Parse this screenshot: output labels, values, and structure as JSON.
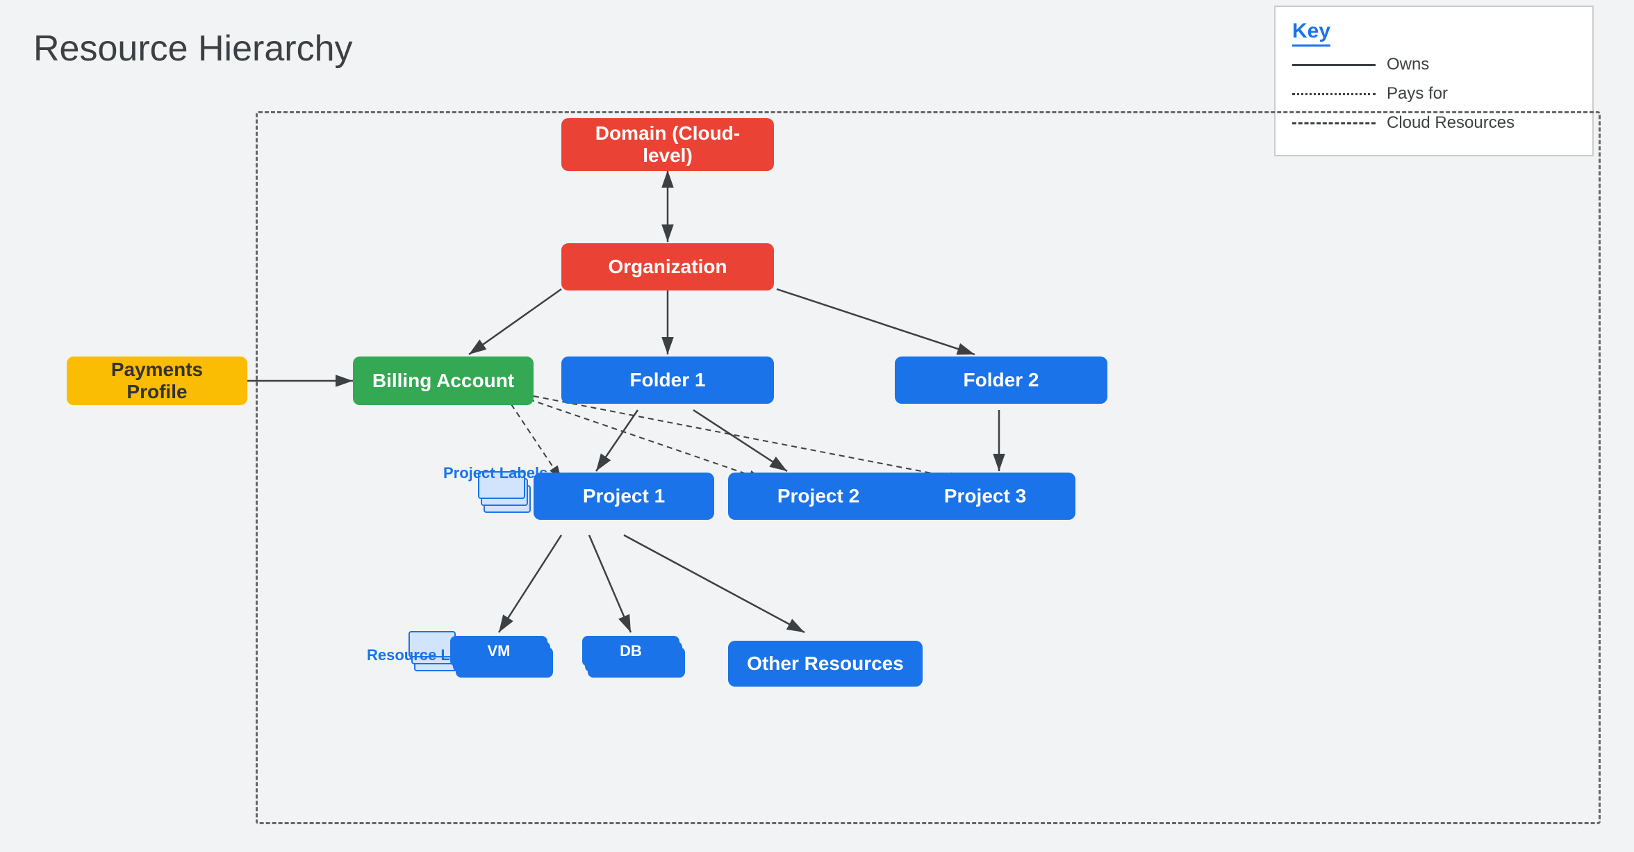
{
  "title": "Resource Hierarchy",
  "key": {
    "title": "Key",
    "items": [
      {
        "label": "Owns",
        "type": "solid"
      },
      {
        "label": "Pays for",
        "type": "dotted"
      },
      {
        "label": "Cloud Resources",
        "type": "dashed"
      }
    ]
  },
  "nodes": {
    "domain": "Domain (Cloud-level)",
    "organization": "Organization",
    "billingAccount": "Billing Account",
    "paymentsProfile": "Payments Profile",
    "folder1": "Folder 1",
    "folder2": "Folder 2",
    "project1": "Project 1",
    "project2": "Project 2",
    "project3": "Project 3",
    "vm": "VM",
    "db": "DB",
    "otherResources": "Other Resources",
    "projectLabels": "Project\nLabels",
    "resourceLabels": "Resource\nLabels"
  }
}
